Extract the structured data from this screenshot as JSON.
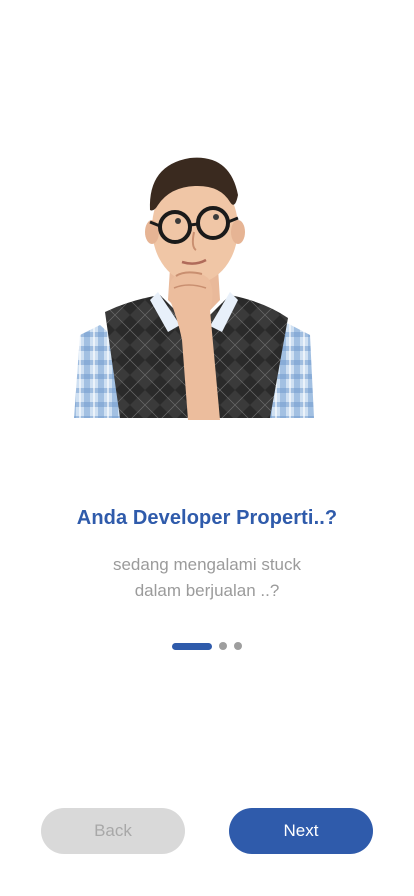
{
  "onboarding": {
    "illustration": "thinking-man-illustration",
    "title": "Anda Developer Properti..?",
    "subtitle_line1": "sedang mengalami stuck",
    "subtitle_line2": "dalam berjualan ..?",
    "page_indicator": {
      "total": 3,
      "current": 1
    }
  },
  "buttons": {
    "back_label": "Back",
    "next_label": "Next"
  },
  "colors": {
    "accent": "#2f5bab",
    "muted_text": "#9b9b9b",
    "back_button_bg": "#d9d9d9",
    "dot_inactive": "#9e9e9e"
  }
}
